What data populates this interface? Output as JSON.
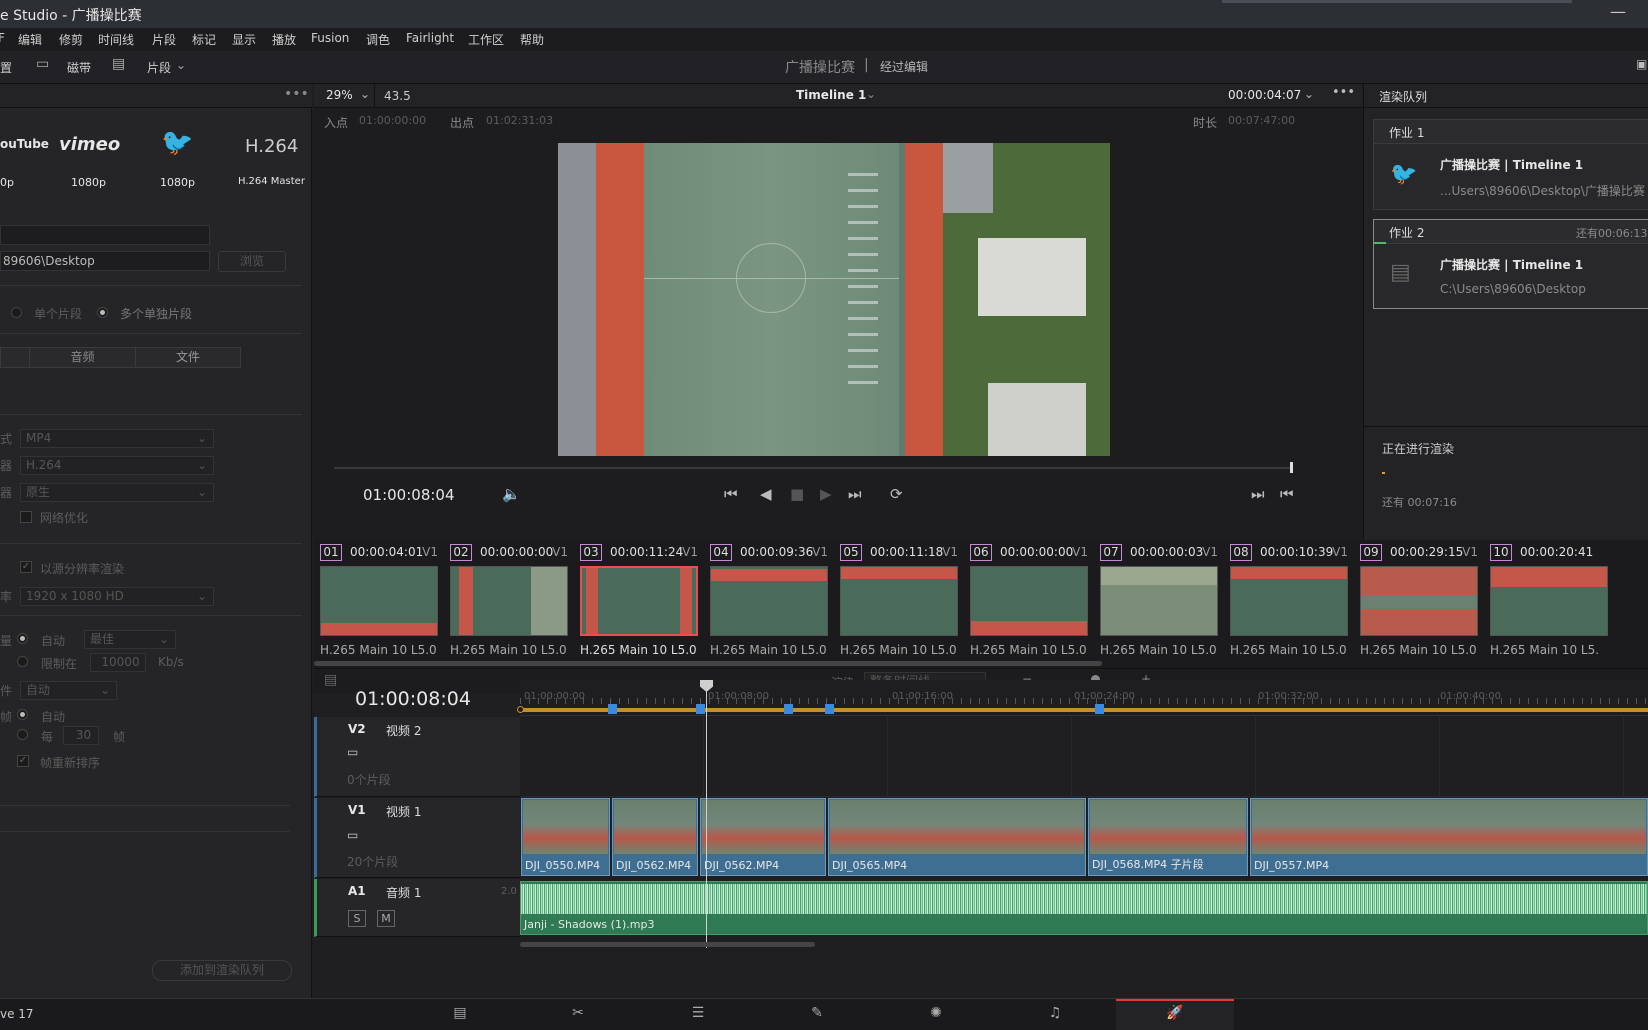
{
  "window": {
    "title": "e Studio - 广播操比赛"
  },
  "menu": {
    "items": [
      "F",
      "编辑",
      "修剪",
      "时间线",
      "片段",
      "标记",
      "显示",
      "播放",
      "Fusion",
      "调色",
      "Fairlight",
      "工作区",
      "帮助"
    ]
  },
  "toolbar": {
    "left_label": "置",
    "tape_label": "磁带",
    "clip_label": "片段",
    "project_name": "广播操比赛",
    "divider": "|",
    "edit_state": "经过编辑"
  },
  "left": {
    "presets": [
      {
        "name": "ouTube",
        "res": "0p"
      },
      {
        "name": "vimeo",
        "res": "1080p"
      },
      {
        "name": "twitter-icon",
        "res": "1080p"
      },
      {
        "name": "H.264",
        "res": "H.264 Master"
      }
    ],
    "location_value": "89606\\Desktop",
    "browse_label": "浏览",
    "single_clip": "单个片段",
    "multi_clip": "多个单独片段",
    "tabs": [
      "",
      "音频",
      "文件"
    ],
    "format_label": "式",
    "format_value": "MP4",
    "codec_label": "器",
    "codec_value": "H.264",
    "encoder_label": "器",
    "encoder_value": "原生",
    "network_opt": "网络优化",
    "source_res": "以源分辨率渲染",
    "res_label": "率",
    "res_value": "1920 x 1080 HD",
    "quality_label": "量",
    "auto_label": "自动",
    "best_value": "最佳",
    "limit_label": "限制在",
    "limit_value": "10000",
    "kbs": "Kb/s",
    "encode_label": "件",
    "encode_value": "自动",
    "keyframe_label": "帧",
    "every_label": "每",
    "every_value": "30",
    "frame_unit": "帧",
    "reorder": "帧重新排序",
    "add_queue": "添加到渲染队列",
    "version": "ve 17"
  },
  "viewer": {
    "zoom": "29%",
    "zoom_value": "43.5",
    "timeline_name": "Timeline 1",
    "tc_top": "00:00:04:07",
    "in_label": "入点",
    "in_value": "01:00:00:00",
    "out_label": "出点",
    "out_value": "01:02:31:03",
    "dur_label": "时长",
    "dur_value": "00:07:47:00",
    "current_tc": "01:00:08:04"
  },
  "queue": {
    "title": "渲染队列",
    "jobs": [
      {
        "name": "作业 1",
        "title": "广播操比赛 | Timeline 1",
        "path": "...Users\\89606\\Desktop\\广播操比赛",
        "remaining": ""
      },
      {
        "name": "作业 2",
        "title": "广播操比赛 | Timeline 1",
        "path": "C:\\Users\\89606\\Desktop",
        "remaining": "还有00:06:13"
      }
    ],
    "status": "正在进行渲染",
    "remaining_total": "还有 00:07:16"
  },
  "clips": [
    {
      "num": "01",
      "tc": "00:00:04:01",
      "track": "V1",
      "codec": "H.265 Main 10 L5.0",
      "color": "#c88ad8"
    },
    {
      "num": "02",
      "tc": "00:00:00:00",
      "track": "V1",
      "codec": "H.265 Main 10 L5.0",
      "color": "#c88ad8"
    },
    {
      "num": "03",
      "tc": "00:00:11:24",
      "track": "V1",
      "codec": "H.265 Main 10 L5.0",
      "color": "#c88ad8"
    },
    {
      "num": "04",
      "tc": "00:00:09:36",
      "track": "V1",
      "codec": "H.265 Main 10 L5.0",
      "color": "#c88ad8"
    },
    {
      "num": "05",
      "tc": "00:00:11:18",
      "track": "V1",
      "codec": "H.265 Main 10 L5.0",
      "color": "#c88ad8"
    },
    {
      "num": "06",
      "tc": "00:00:00:00",
      "track": "V1",
      "codec": "H.265 Main 10 L5.0",
      "color": "#c88ad8"
    },
    {
      "num": "07",
      "tc": "00:00:00:03",
      "track": "V1",
      "codec": "H.265 Main 10 L5.0",
      "color": "#c88ad8"
    },
    {
      "num": "08",
      "tc": "00:00:10:39",
      "track": "V1",
      "codec": "H.265 Main 10 L5.0",
      "color": "#c88ad8"
    },
    {
      "num": "09",
      "tc": "00:00:29:15",
      "track": "V1",
      "codec": "H.265 Main 10 L5.0",
      "color": "#c88ad8"
    },
    {
      "num": "10",
      "tc": "00:00:20:41",
      "track": "V1",
      "codec": "H.265 Main 10 L5.",
      "color": "#c88ad8"
    }
  ],
  "timeline": {
    "render_label": "渲染",
    "render_range": "整条时间线",
    "tc": "01:00:08:04",
    "ruler": [
      "01:00:00:00",
      "01:00:08:00",
      "01:00:16:00",
      "01:00:24:00",
      "01:00:32:00",
      "01:00:40:00"
    ],
    "v2": {
      "id": "V2",
      "name": "视频 2",
      "count": "0个片段"
    },
    "v1": {
      "id": "V1",
      "name": "视频 1",
      "count": "20个片段"
    },
    "a1": {
      "id": "A1",
      "name": "音频 1",
      "level": "2.0",
      "s": "S",
      "m": "M"
    },
    "v1_clips": [
      "DJI_0550.MP4",
      "DJI_0562.MP4",
      "DJI_0562.MP4",
      "DJI_0565.MP4",
      "DJI_0568.MP4 子片段",
      "DJI_0557.MP4"
    ],
    "audio_clip": "Janji - Shadows (1).mp3"
  }
}
